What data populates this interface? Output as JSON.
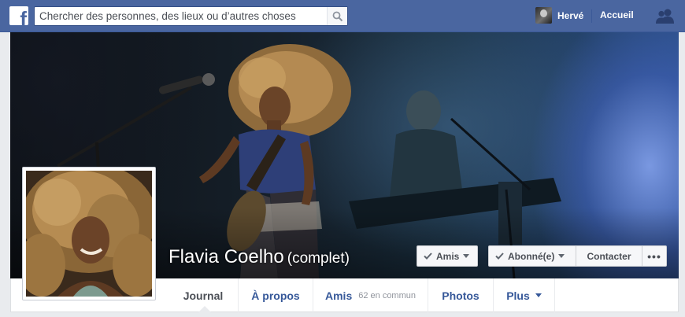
{
  "topbar": {
    "logo": "f",
    "search": {
      "placeholder": "Chercher des personnes, des lieux ou d’autres choses",
      "value": ""
    },
    "user_name": "Hervé",
    "home_label": "Accueil",
    "icons": {
      "search": "magnifier-icon",
      "friends": "friends-requests-icon"
    }
  },
  "profile": {
    "name": "Flavia Coelho",
    "name_suffix": "(complet)"
  },
  "actions": {
    "friends_label": "Amis",
    "following_label": "Abonné(e)",
    "message_label": "Contacter",
    "more_label": "•••"
  },
  "tabs": [
    {
      "label": "Journal",
      "active": true
    },
    {
      "label": "À propos"
    },
    {
      "label": "Amis",
      "meta": "62 en commun"
    },
    {
      "label": "Photos"
    },
    {
      "label": "Plus"
    }
  ],
  "colors": {
    "brand": "#4a66a0",
    "link": "#365899",
    "button_bg": "#f6f7f9"
  }
}
